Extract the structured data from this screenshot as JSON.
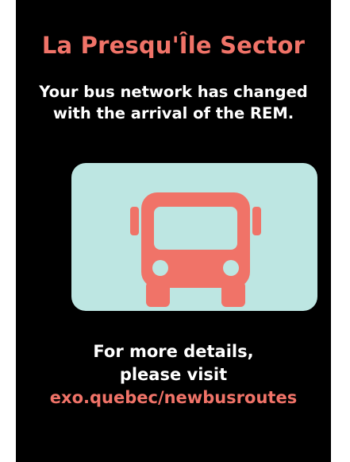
{
  "poster": {
    "title": "La Presqu'Île Sector",
    "subtitle_line1": "Your bus network has changed",
    "subtitle_line2": "with the arrival of the REM.",
    "details_line1": "For more details,",
    "details_line2": "please visit",
    "link_text": "exo.quebec/newbusroutes"
  },
  "icons": {
    "bus": "bus-icon"
  },
  "colors": {
    "background": "#000000",
    "accent": "#f07368",
    "card": "#bde6e2",
    "text": "#ffffff"
  }
}
